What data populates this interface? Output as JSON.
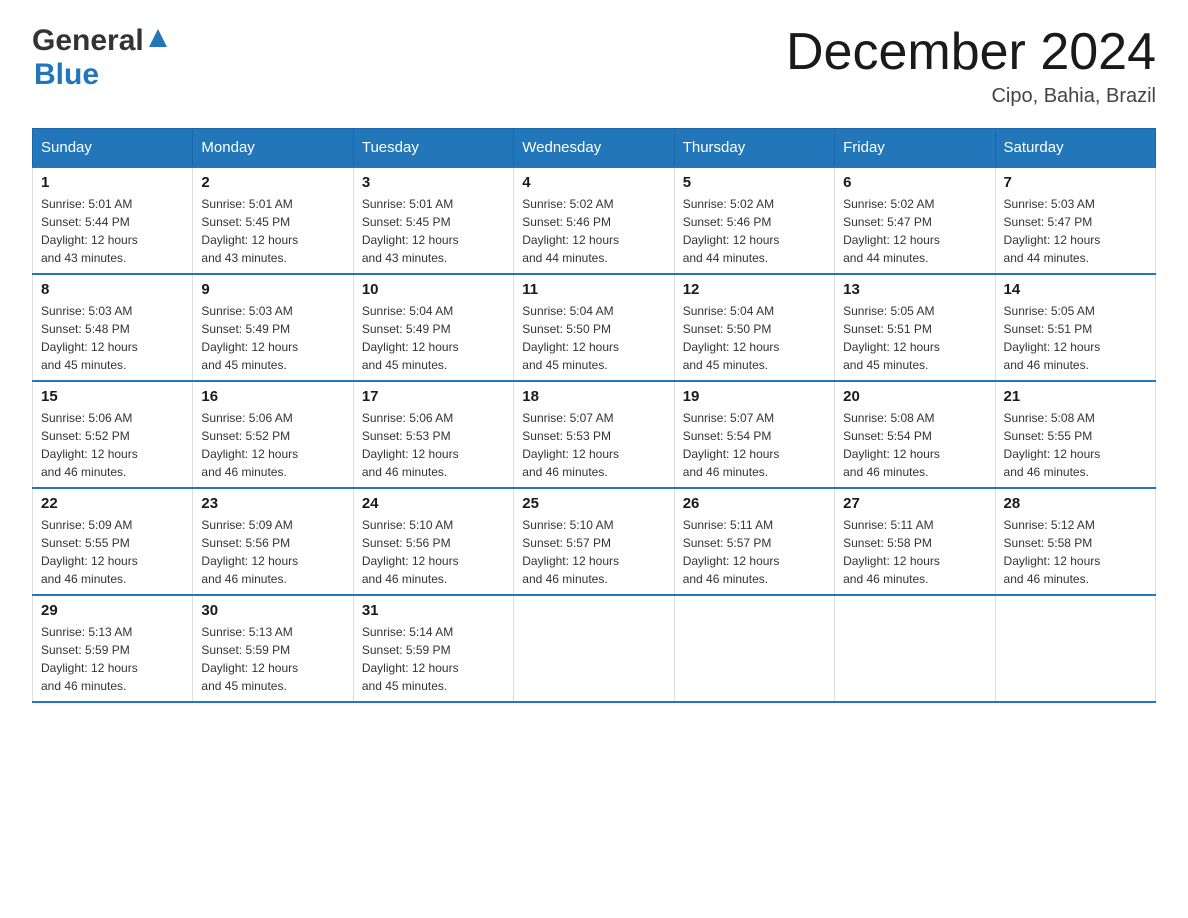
{
  "logo": {
    "word1": "General",
    "word2": "Blue"
  },
  "header": {
    "month": "December 2024",
    "location": "Cipo, Bahia, Brazil"
  },
  "days_of_week": [
    "Sunday",
    "Monday",
    "Tuesday",
    "Wednesday",
    "Thursday",
    "Friday",
    "Saturday"
  ],
  "weeks": [
    [
      {
        "day": "1",
        "sunrise": "5:01 AM",
        "sunset": "5:44 PM",
        "daylight": "12 hours and 43 minutes."
      },
      {
        "day": "2",
        "sunrise": "5:01 AM",
        "sunset": "5:45 PM",
        "daylight": "12 hours and 43 minutes."
      },
      {
        "day": "3",
        "sunrise": "5:01 AM",
        "sunset": "5:45 PM",
        "daylight": "12 hours and 43 minutes."
      },
      {
        "day": "4",
        "sunrise": "5:02 AM",
        "sunset": "5:46 PM",
        "daylight": "12 hours and 44 minutes."
      },
      {
        "day": "5",
        "sunrise": "5:02 AM",
        "sunset": "5:46 PM",
        "daylight": "12 hours and 44 minutes."
      },
      {
        "day": "6",
        "sunrise": "5:02 AM",
        "sunset": "5:47 PM",
        "daylight": "12 hours and 44 minutes."
      },
      {
        "day": "7",
        "sunrise": "5:03 AM",
        "sunset": "5:47 PM",
        "daylight": "12 hours and 44 minutes."
      }
    ],
    [
      {
        "day": "8",
        "sunrise": "5:03 AM",
        "sunset": "5:48 PM",
        "daylight": "12 hours and 45 minutes."
      },
      {
        "day": "9",
        "sunrise": "5:03 AM",
        "sunset": "5:49 PM",
        "daylight": "12 hours and 45 minutes."
      },
      {
        "day": "10",
        "sunrise": "5:04 AM",
        "sunset": "5:49 PM",
        "daylight": "12 hours and 45 minutes."
      },
      {
        "day": "11",
        "sunrise": "5:04 AM",
        "sunset": "5:50 PM",
        "daylight": "12 hours and 45 minutes."
      },
      {
        "day": "12",
        "sunrise": "5:04 AM",
        "sunset": "5:50 PM",
        "daylight": "12 hours and 45 minutes."
      },
      {
        "day": "13",
        "sunrise": "5:05 AM",
        "sunset": "5:51 PM",
        "daylight": "12 hours and 45 minutes."
      },
      {
        "day": "14",
        "sunrise": "5:05 AM",
        "sunset": "5:51 PM",
        "daylight": "12 hours and 46 minutes."
      }
    ],
    [
      {
        "day": "15",
        "sunrise": "5:06 AM",
        "sunset": "5:52 PM",
        "daylight": "12 hours and 46 minutes."
      },
      {
        "day": "16",
        "sunrise": "5:06 AM",
        "sunset": "5:52 PM",
        "daylight": "12 hours and 46 minutes."
      },
      {
        "day": "17",
        "sunrise": "5:06 AM",
        "sunset": "5:53 PM",
        "daylight": "12 hours and 46 minutes."
      },
      {
        "day": "18",
        "sunrise": "5:07 AM",
        "sunset": "5:53 PM",
        "daylight": "12 hours and 46 minutes."
      },
      {
        "day": "19",
        "sunrise": "5:07 AM",
        "sunset": "5:54 PM",
        "daylight": "12 hours and 46 minutes."
      },
      {
        "day": "20",
        "sunrise": "5:08 AM",
        "sunset": "5:54 PM",
        "daylight": "12 hours and 46 minutes."
      },
      {
        "day": "21",
        "sunrise": "5:08 AM",
        "sunset": "5:55 PM",
        "daylight": "12 hours and 46 minutes."
      }
    ],
    [
      {
        "day": "22",
        "sunrise": "5:09 AM",
        "sunset": "5:55 PM",
        "daylight": "12 hours and 46 minutes."
      },
      {
        "day": "23",
        "sunrise": "5:09 AM",
        "sunset": "5:56 PM",
        "daylight": "12 hours and 46 minutes."
      },
      {
        "day": "24",
        "sunrise": "5:10 AM",
        "sunset": "5:56 PM",
        "daylight": "12 hours and 46 minutes."
      },
      {
        "day": "25",
        "sunrise": "5:10 AM",
        "sunset": "5:57 PM",
        "daylight": "12 hours and 46 minutes."
      },
      {
        "day": "26",
        "sunrise": "5:11 AM",
        "sunset": "5:57 PM",
        "daylight": "12 hours and 46 minutes."
      },
      {
        "day": "27",
        "sunrise": "5:11 AM",
        "sunset": "5:58 PM",
        "daylight": "12 hours and 46 minutes."
      },
      {
        "day": "28",
        "sunrise": "5:12 AM",
        "sunset": "5:58 PM",
        "daylight": "12 hours and 46 minutes."
      }
    ],
    [
      {
        "day": "29",
        "sunrise": "5:13 AM",
        "sunset": "5:59 PM",
        "daylight": "12 hours and 46 minutes."
      },
      {
        "day": "30",
        "sunrise": "5:13 AM",
        "sunset": "5:59 PM",
        "daylight": "12 hours and 45 minutes."
      },
      {
        "day": "31",
        "sunrise": "5:14 AM",
        "sunset": "5:59 PM",
        "daylight": "12 hours and 45 minutes."
      },
      null,
      null,
      null,
      null
    ]
  ],
  "labels": {
    "sunrise": "Sunrise:",
    "sunset": "Sunset:",
    "daylight": "Daylight:"
  }
}
